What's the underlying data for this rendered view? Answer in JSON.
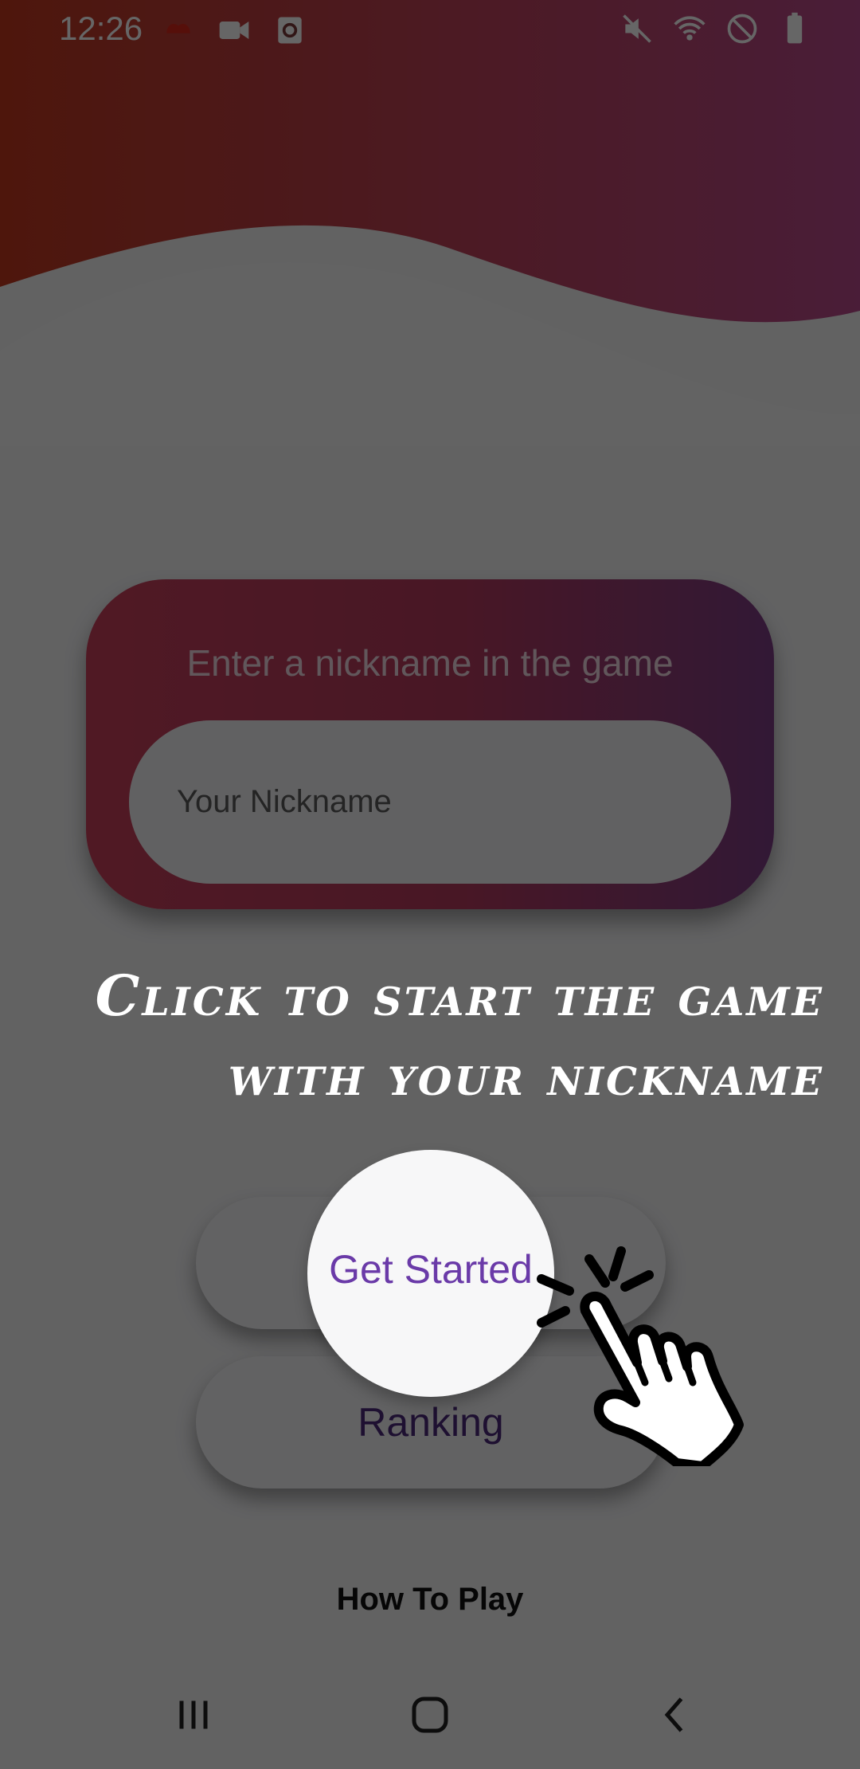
{
  "status_bar": {
    "time": "12:26",
    "left_icons": [
      "notification-icon",
      "video-camera-icon",
      "screen-record-icon"
    ],
    "right_icons": [
      "mute-icon",
      "wifi-icon",
      "do-not-disturb-icon",
      "battery-icon"
    ]
  },
  "nickname_card": {
    "label": "Enter a nickname in the game",
    "input_placeholder": "Your Nickname",
    "input_value": ""
  },
  "buttons": {
    "get_started": "Get Started",
    "ranking": "Ranking",
    "how_to_play": "How To Play"
  },
  "tutorial_overlay": {
    "hint_line_1": "Click to start the game",
    "hint_line_2": "with your nickname",
    "highlight_label": "Get Started",
    "pointer_icon": "hand-pointer-icon"
  },
  "nav_bar": {
    "icons": [
      "recent-apps-icon",
      "home-icon",
      "back-icon"
    ]
  },
  "colors": {
    "header_wave_start": "#c2391f",
    "header_wave_end": "#b94a8c",
    "card_gradient_start": "#c9405b",
    "card_gradient_end": "#7d3d86",
    "accent_purple": "#6a3aa8",
    "overlay": "rgba(0,0,0,0.6)"
  }
}
